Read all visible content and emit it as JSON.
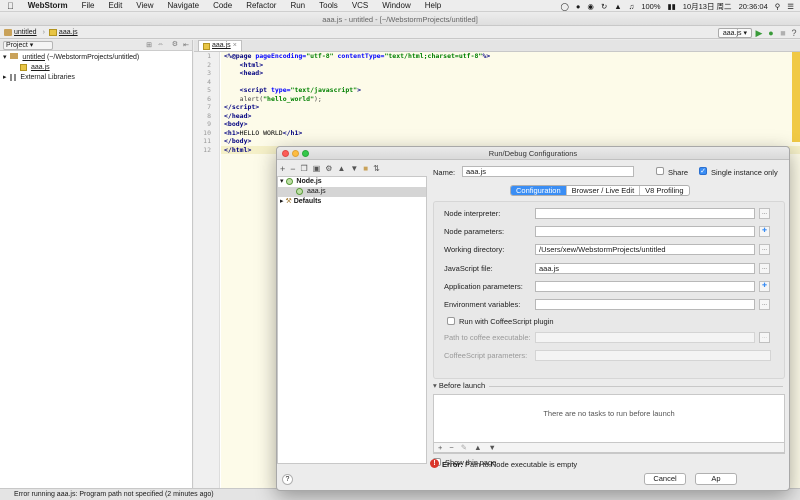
{
  "menubar": {
    "app": "WebStorm",
    "items": [
      "File",
      "Edit",
      "View",
      "Navigate",
      "Code",
      "Refactor",
      "Run",
      "Tools",
      "VCS",
      "Window",
      "Help"
    ],
    "battery": "100%",
    "date": "10月13日 周二",
    "time": "20:36:04"
  },
  "window_title": "aaa.js - untitled - [~/WebstormProjects/untitled]",
  "nav": {
    "crumb1": "untitled",
    "crumb2": "aaa.js",
    "run_config": "aaa.js"
  },
  "project": {
    "selector": "Project",
    "root_name": "untitled",
    "root_path": "(~/WebstormProjects/untitled)",
    "file": "aaa.js",
    "external": "External Libraries"
  },
  "editor": {
    "tab": "aaa.js",
    "line_numbers": [
      "1",
      "2",
      "3",
      "4",
      "5",
      "6",
      "7",
      "8",
      "9",
      "10",
      "11",
      "12"
    ]
  },
  "status": {
    "message": "Error running aaa.js: Program path not specified (2 minutes ago)"
  },
  "dialog": {
    "title": "Run/Debug Configurations",
    "tree": {
      "node": "Node.js",
      "child": "aaa.js",
      "defaults": "Defaults"
    },
    "name_label": "Name:",
    "name_value": "aaa.js",
    "share_label": "Share",
    "single_instance_label": "Single instance only",
    "tabs": [
      "Configuration",
      "Browser / Live Edit",
      "V8 Profiling"
    ],
    "fields": {
      "node_interpreter": "Node interpreter:",
      "node_parameters": "Node parameters:",
      "working_directory": "Working directory:",
      "working_directory_value": "/Users/xew/WebstormProjects/untitled",
      "javascript_file": "JavaScript file:",
      "javascript_file_value": "aaa.js",
      "application_parameters": "Application parameters:",
      "environment_variables": "Environment variables:",
      "coffee_plugin": "Run with CoffeeScript plugin",
      "coffee_path": "Path to coffee executable:",
      "coffee_params": "CoffeeScript parameters:"
    },
    "before_launch": {
      "title": "Before launch",
      "empty": "There are no tasks to run before launch"
    },
    "show_page": "Show this page",
    "error_label": "Error:",
    "error_text": "Path to Node executable is empty",
    "cancel": "Cancel",
    "apply": "Ap",
    "help": "?"
  },
  "colors": {
    "accent": "#3b8ef4",
    "error": "#d9362b",
    "code_bg": "#fdfbe9"
  }
}
